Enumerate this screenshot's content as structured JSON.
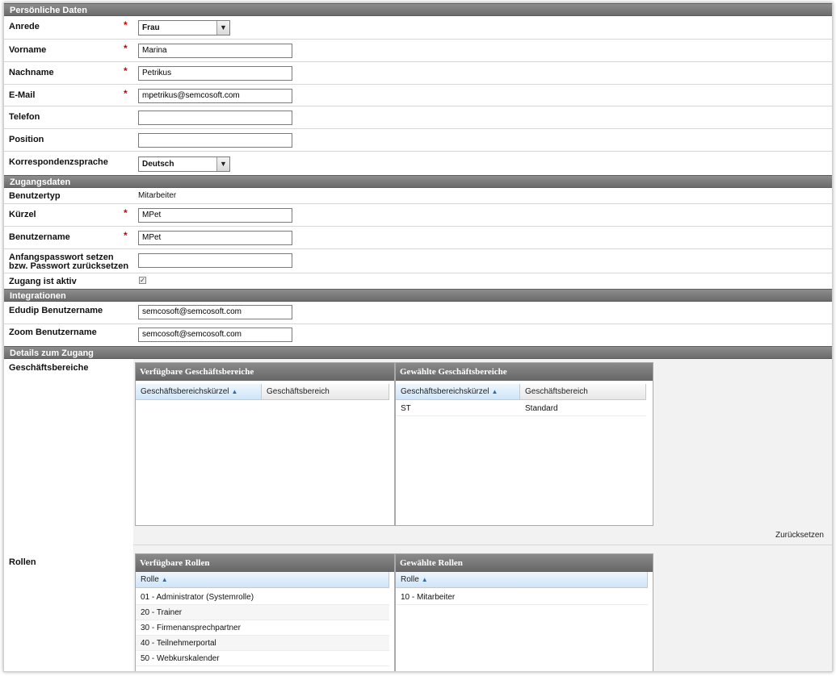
{
  "sections": {
    "personal": "Persönliche Daten",
    "access": "Zugangsdaten",
    "integrations": "Integrationen",
    "details": "Details zum Zugang"
  },
  "fields": {
    "anrede": {
      "label": "Anrede",
      "value": "Frau"
    },
    "vorname": {
      "label": "Vorname",
      "value": "Marina"
    },
    "nachname": {
      "label": "Nachname",
      "value": "Petrikus"
    },
    "email": {
      "label": "E-Mail",
      "value": "mpetrikus@semcosoft.com"
    },
    "telefon": {
      "label": "Telefon",
      "value": ""
    },
    "position": {
      "label": "Position",
      "value": ""
    },
    "korrespondenz": {
      "label": "Korrespondenzsprache",
      "value": "Deutsch"
    },
    "benutzertyp": {
      "label": "Benutzertyp",
      "value": "Mitarbeiter"
    },
    "kuerzel": {
      "label": "Kürzel",
      "value": "MPet"
    },
    "benutzername": {
      "label": "Benutzername",
      "value": "MPet"
    },
    "passwort": {
      "label_line1": "Anfangspasswort setzen",
      "label_line2": "bzw. Passwort zurücksetzen",
      "value": ""
    },
    "aktiv": {
      "label": "Zugang ist aktiv",
      "checked": true
    },
    "edudip": {
      "label": "Edudip Benutzername",
      "value": "semcosoft@semcosoft.com"
    },
    "zoom": {
      "label": "Zoom Benutzername",
      "value": "semcosoft@semcosoft.com"
    }
  },
  "required_mark": "*",
  "geschaeftsbereiche": {
    "label": "Geschäftsbereiche",
    "available_title": "Verfügbare Geschäftsbereiche",
    "selected_title": "Gewählte Geschäftsbereiche",
    "col_code": "Geschäftsbereichskürzel",
    "col_name": "Geschäftsbereich",
    "selected_rows": [
      {
        "code": "ST",
        "name": "Standard"
      }
    ],
    "reset": "Zurücksetzen"
  },
  "rollen": {
    "label": "Rollen",
    "available_title": "Verfügbare Rollen",
    "selected_title": "Gewählte Rollen",
    "col_role": "Rolle",
    "available_rows": [
      "01 - Administrator (Systemrolle)",
      "20 - Trainer",
      "30 - Firmenansprechpartner",
      "40 - Teilnehmerportal",
      "50 - Webkurskalender"
    ],
    "selected_rows": [
      "10 - Mitarbeiter"
    ]
  },
  "icons": {
    "dropdown": "chevron-down-icon",
    "sort": "sort-ascending-icon",
    "check": "checkmark-icon"
  }
}
